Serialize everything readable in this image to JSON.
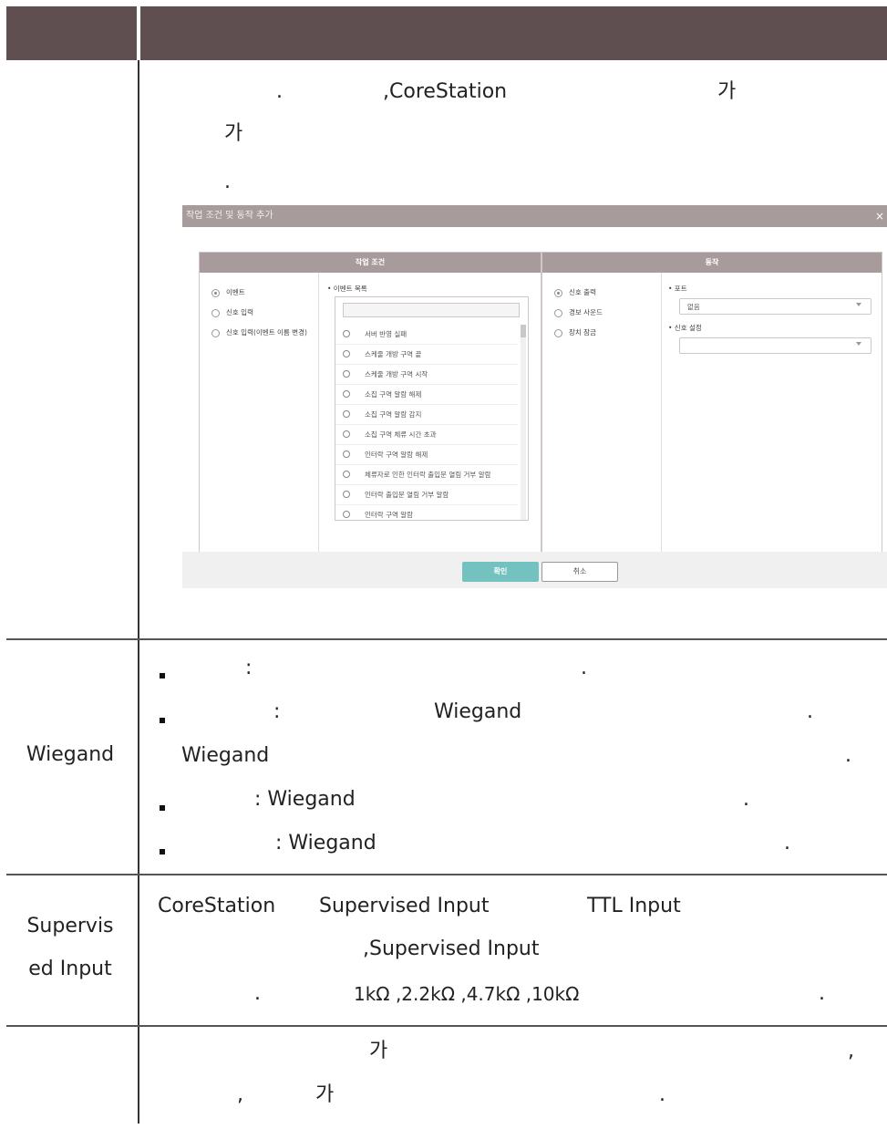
{
  "row1": {
    "line1_a": ".",
    "line1_b": ",CoreStation",
    "line1_c": "가",
    "line2": "가",
    "line3": "."
  },
  "dialog": {
    "title": "작업 조건 및 동작 추가",
    "close": "×",
    "left_header": "작업 조건",
    "right_header": "동작",
    "radios": [
      "이벤트",
      "신호 입력",
      "신호 입력(이벤트 이름 변경)"
    ],
    "event_list_label": "• 이벤트 목록",
    "events": [
      "서버 반영 실패",
      "스케줄 개방 구역 끝",
      "스케줄 개방 구역 시작",
      "소집 구역 알람 해제",
      "소집 구역 알람 감지",
      "소집 구역 체류 시간 초과",
      "인터락 구역 알람 해제",
      "체류자로 인한 인터락 출입문 열림 거부 알람",
      "인터락 출입문 열림 거부 알람",
      "인터락 구역 알람"
    ],
    "actions": [
      "신호 출력",
      "경보 사운드",
      "장치 잠금"
    ],
    "port_label": "• 포트",
    "port_value": "없음",
    "signal_label": "• 신호 설정",
    "signal_value": "",
    "ok": "확인",
    "cancel": "취소"
  },
  "row2": {
    "label": "Wiegand",
    "b1_a": ":",
    "b1_b": ".",
    "b2_a": ":",
    "b2_b": "Wiegand",
    "b2_c": ".",
    "b2_cont": "Wiegand",
    "b2_cont_end": ".",
    "b3_a": ": Wiegand",
    "b3_b": ".",
    "b4_a": ": Wiegand",
    "b4_b": "."
  },
  "row3": {
    "label_1": "Supervis",
    "label_2": "ed Input",
    "l1_a": "CoreStation",
    "l1_b": "Supervised Input",
    "l1_c": "TTL Input",
    "l2": ",Supervised Input",
    "l3_a": ".",
    "l3_b": "1kΩ ,2.2kΩ ,4.7kΩ ,10kΩ",
    "l3_c": "."
  },
  "row4": {
    "l1_a": "가",
    "l1_b": ",",
    "l2_a": ",",
    "l2_b": "가",
    "l2_c": "."
  }
}
